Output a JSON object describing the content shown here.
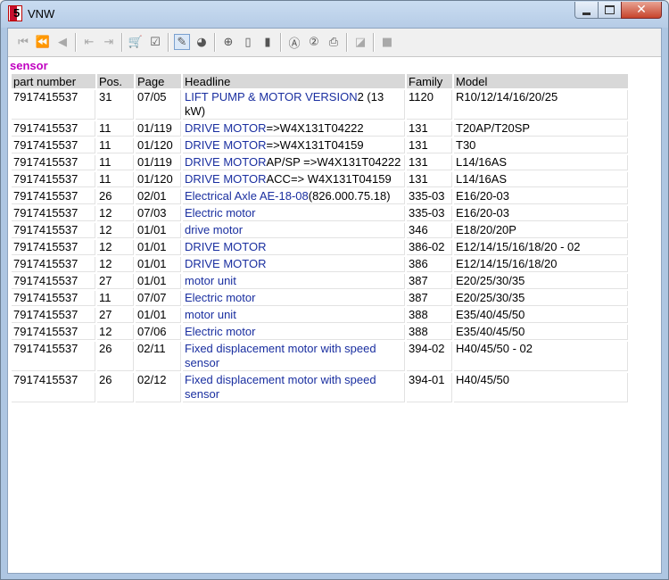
{
  "window": {
    "title": "VNW"
  },
  "toolbar": [
    {
      "icon": "first-record-icon",
      "glyph": "⏮",
      "disabled": true
    },
    {
      "icon": "previous-page-icon",
      "glyph": "⏪",
      "disabled": true
    },
    {
      "icon": "previous-record-icon",
      "glyph": "◀",
      "disabled": true
    },
    {
      "icon": "document-back-icon",
      "glyph": "⇤",
      "disabled": true
    },
    {
      "icon": "document-forward-icon",
      "glyph": "⇥",
      "disabled": true
    },
    {
      "icon": "cart-icon",
      "glyph": "🛒",
      "disabled": false
    },
    {
      "icon": "checklist-icon",
      "glyph": "☑",
      "disabled": false
    },
    {
      "icon": "pencil-icon",
      "glyph": "✎",
      "disabled": false,
      "active": true
    },
    {
      "icon": "globe-icon",
      "glyph": "◕",
      "disabled": false
    },
    {
      "icon": "zoom-icon",
      "glyph": "⊕",
      "disabled": false
    },
    {
      "icon": "page-icon",
      "glyph": "▯",
      "disabled": false
    },
    {
      "icon": "page-alt-icon",
      "glyph": "▮",
      "disabled": false
    },
    {
      "icon": "a-circle-icon",
      "glyph": "Ⓐ",
      "disabled": false
    },
    {
      "icon": "two-circle-icon",
      "glyph": "②",
      "disabled": false
    },
    {
      "icon": "print-icon",
      "glyph": "⎙",
      "disabled": false
    },
    {
      "icon": "eraser-icon",
      "glyph": "◪",
      "disabled": true
    },
    {
      "icon": "stop-icon",
      "glyph": "■",
      "disabled": true
    }
  ],
  "section_title": "sensor",
  "columns": [
    "part number",
    "Pos.",
    "Page",
    "Headline",
    "Family",
    "Model"
  ],
  "rows": [
    {
      "part": "7917415537",
      "pos": "31",
      "page": "07/05",
      "headline": "LIFT PUMP & MOTOR VERSION",
      "headline_rest": "2 (13 kW)",
      "family": "1120",
      "model": "R10/12/14/16/20/25"
    },
    {
      "part": "7917415537",
      "pos": "11",
      "page": "01/119",
      "headline": "DRIVE MOTOR",
      "headline_rest": "=>W4X131T04222",
      "family": "131",
      "model": "T20AP/T20SP"
    },
    {
      "part": "7917415537",
      "pos": "11",
      "page": "01/120",
      "headline": "DRIVE MOTOR",
      "headline_rest": "=>W4X131T04159",
      "family": "131",
      "model": "T30"
    },
    {
      "part": "7917415537",
      "pos": "11",
      "page": "01/119",
      "headline": "DRIVE MOTOR",
      "headline_rest": "AP/SP =>W4X131T04222",
      "family": "131",
      "model": "L14/16AS"
    },
    {
      "part": "7917415537",
      "pos": "11",
      "page": "01/120",
      "headline": "DRIVE MOTOR",
      "headline_rest": "ACC=> W4X131T04159",
      "family": "131",
      "model": "L14/16AS"
    },
    {
      "part": "7917415537",
      "pos": "26",
      "page": "02/01",
      "headline": "Electrical Axle  AE-18-08",
      "headline_rest": "(826.000.75.18)",
      "family": "335-03",
      "model": "E16/20-03"
    },
    {
      "part": "7917415537",
      "pos": "12",
      "page": "07/03",
      "headline": "Electric motor",
      "headline_rest": "",
      "family": "335-03",
      "model": "E16/20-03"
    },
    {
      "part": "7917415537",
      "pos": "12",
      "page": "01/01",
      "headline": "drive motor",
      "headline_rest": "",
      "family": "346",
      "model": "E18/20/20P"
    },
    {
      "part": "7917415537",
      "pos": "12",
      "page": "01/01",
      "headline": "DRIVE MOTOR",
      "headline_rest": "",
      "family": "386-02",
      "model": "E12/14/15/16/18/20 - 02"
    },
    {
      "part": "7917415537",
      "pos": "12",
      "page": "01/01",
      "headline": "DRIVE MOTOR",
      "headline_rest": "",
      "family": "386",
      "model": "E12/14/15/16/18/20"
    },
    {
      "part": "7917415537",
      "pos": "27",
      "page": "01/01",
      "headline": "motor unit",
      "headline_rest": "",
      "family": "387",
      "model": "E20/25/30/35"
    },
    {
      "part": "7917415537",
      "pos": "11",
      "page": "07/07",
      "headline": "Electric motor",
      "headline_rest": "",
      "family": "387",
      "model": "E20/25/30/35"
    },
    {
      "part": "7917415537",
      "pos": "27",
      "page": "01/01",
      "headline": "motor unit",
      "headline_rest": "",
      "family": "388",
      "model": "E35/40/45/50"
    },
    {
      "part": "7917415537",
      "pos": "12",
      "page": "07/06",
      "headline": "Electric motor",
      "headline_rest": "",
      "family": "388",
      "model": "E35/40/45/50"
    },
    {
      "part": "7917415537",
      "pos": "26",
      "page": "02/11",
      "headline": "Fixed displacement motor with speed sensor",
      "headline_rest": "",
      "family": "394-02",
      "model": "H40/45/50 - 02"
    },
    {
      "part": "7917415537",
      "pos": "26",
      "page": "02/12",
      "headline": "Fixed displacement motor with speed sensor",
      "headline_rest": "",
      "family": "394-01",
      "model": "H40/45/50"
    }
  ]
}
